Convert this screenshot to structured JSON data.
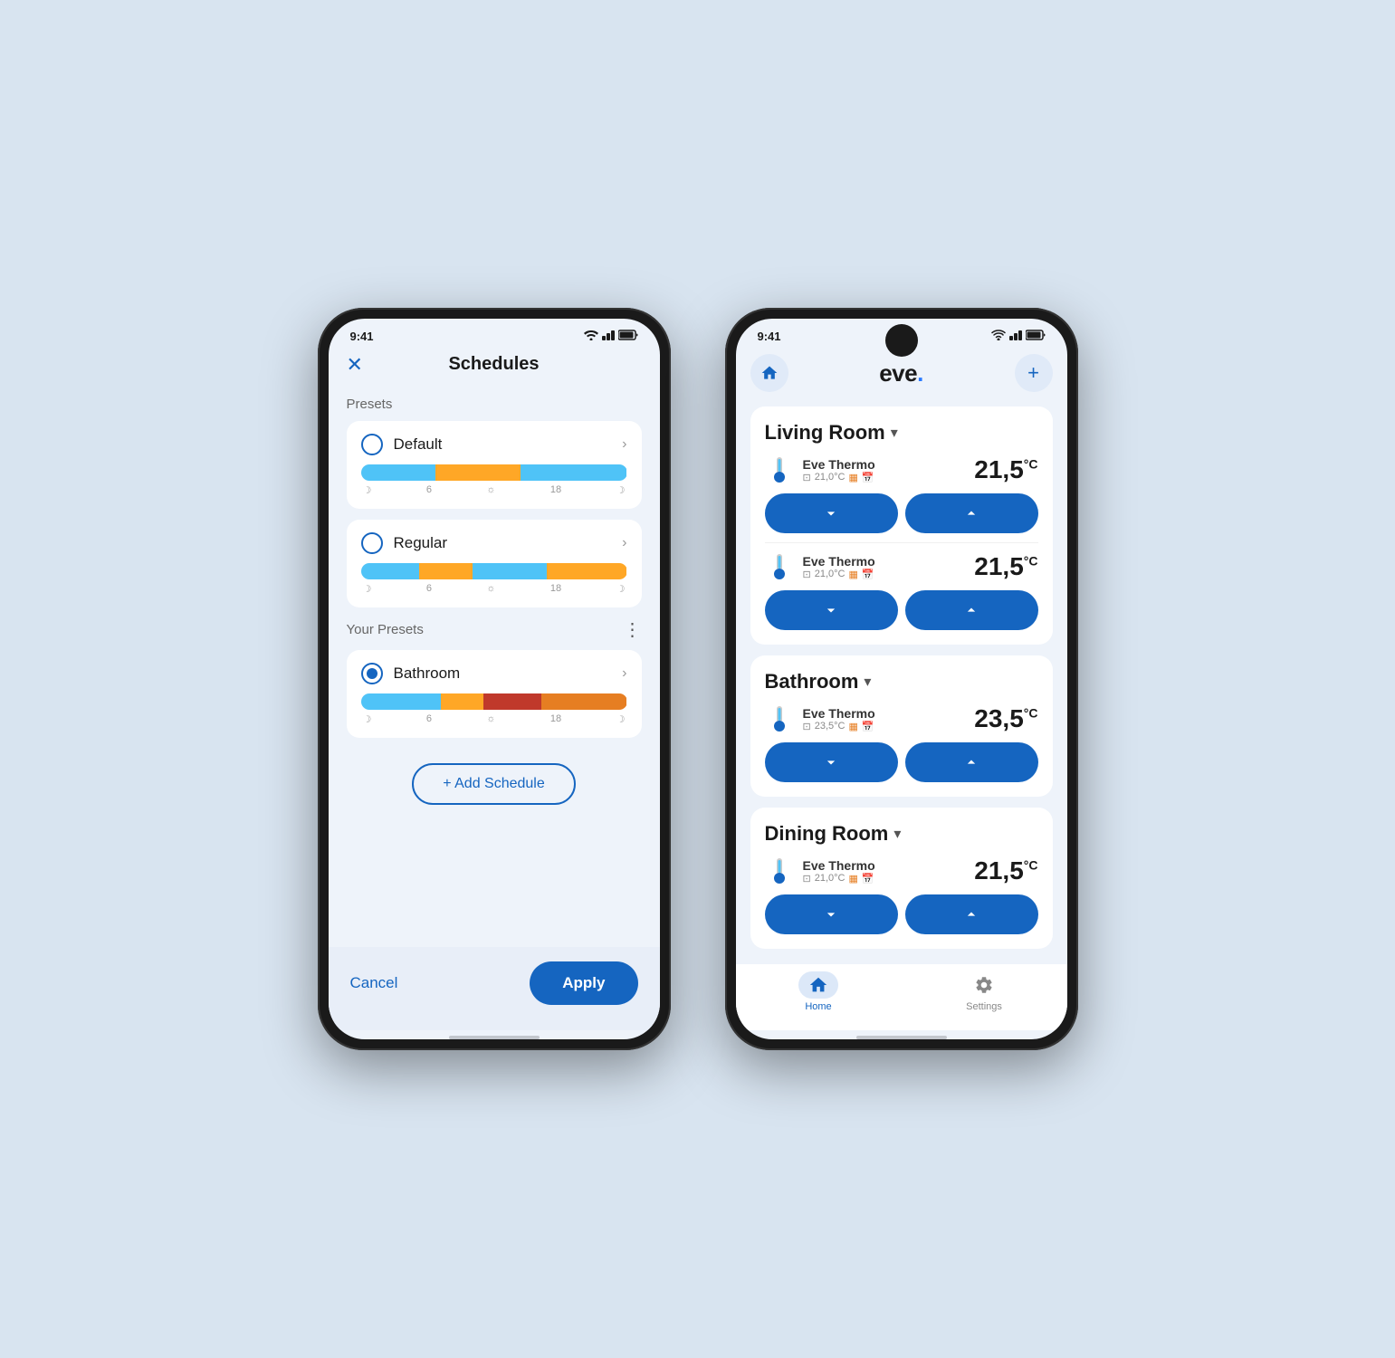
{
  "phone_left": {
    "status": {
      "time": "9:41",
      "signal": "signal",
      "wifi": "wifi",
      "battery": "battery"
    },
    "header": {
      "title": "Schedules",
      "close_icon": "×"
    },
    "presets_label": "Presets",
    "your_presets_label": "Your Presets",
    "presets": [
      {
        "name": "Default",
        "selected": false,
        "bar_segments": [
          {
            "class": "def-1"
          },
          {
            "class": "def-2"
          },
          {
            "class": "def-3"
          }
        ],
        "labels": [
          "☽",
          "6",
          "☼",
          "18",
          "☽"
        ]
      },
      {
        "name": "Regular",
        "selected": false,
        "bar_segments": [
          {
            "class": "reg-1"
          },
          {
            "class": "reg-2"
          },
          {
            "class": "reg-3"
          },
          {
            "class": "reg-4"
          }
        ],
        "labels": [
          "☽",
          "6",
          "☼",
          "18",
          "☽"
        ]
      }
    ],
    "your_presets": [
      {
        "name": "Bathroom",
        "selected": true,
        "bar_segments": [
          {
            "class": "bath-1"
          },
          {
            "class": "bath-2"
          },
          {
            "class": "bath-3"
          },
          {
            "class": "bath-4"
          }
        ],
        "labels": [
          "☽",
          "6",
          "☼",
          "18",
          "☽"
        ]
      }
    ],
    "add_schedule_label": "+ Add Schedule",
    "cancel_label": "Cancel",
    "apply_label": "Apply"
  },
  "phone_right": {
    "status": {
      "time": "9:41"
    },
    "header": {
      "logo": "eve.",
      "home_icon": "home",
      "add_icon": "+"
    },
    "rooms": [
      {
        "name": "Living Room",
        "devices": [
          {
            "name": "Eve Thermo",
            "temp_set": "21,0°C",
            "temp_current": "21,5",
            "temp_unit": "°C",
            "icons": [
              "📋",
              "🔶",
              "📅"
            ]
          },
          {
            "name": "Eve Thermo",
            "temp_set": "21,0°C",
            "temp_current": "21,5",
            "temp_unit": "°C",
            "icons": [
              "📋",
              "🔶",
              "📅"
            ]
          }
        ]
      },
      {
        "name": "Bathroom",
        "devices": [
          {
            "name": "Eve Thermo",
            "temp_set": "23,5°C",
            "temp_current": "23,5",
            "temp_unit": "°C",
            "icons": [
              "📋",
              "🔶",
              "📅"
            ]
          }
        ]
      },
      {
        "name": "Dining Room",
        "devices": [
          {
            "name": "Eve Thermo",
            "temp_set": "21,0°C",
            "temp_current": "21,5",
            "temp_unit": "°C",
            "icons": [
              "📋",
              "🔶",
              "📅"
            ]
          }
        ]
      }
    ],
    "nav": {
      "home_label": "Home",
      "settings_label": "Settings"
    }
  }
}
